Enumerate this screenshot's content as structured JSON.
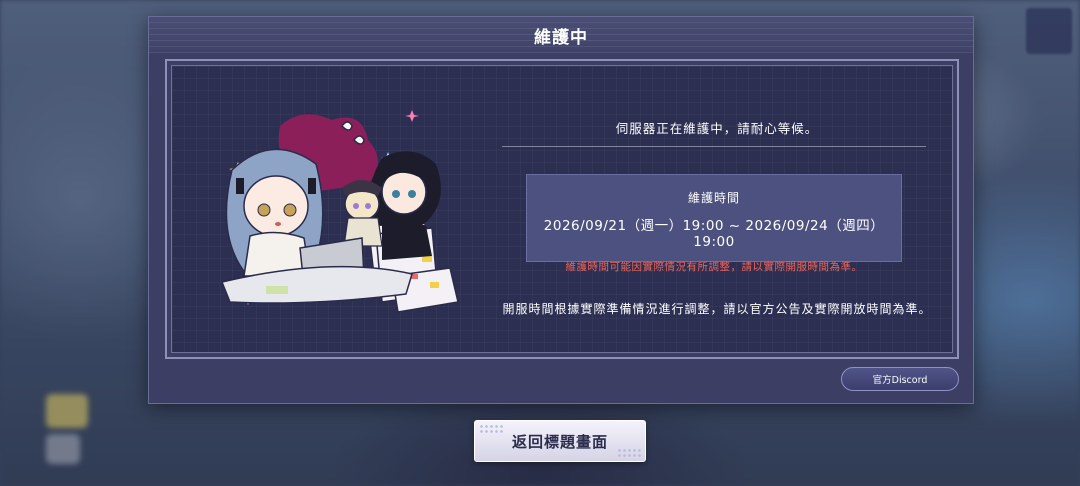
{
  "dialog": {
    "title": "維護中",
    "intro": "伺服器正在維護中，請耐心等候。",
    "maintenance": {
      "label": "維護時間",
      "range": "2026/09/21（週一）19:00 ~ 2026/09/24（週四）19:00",
      "note": "維護時間可能因實際情況有所調整，請以實際開服時間為準。"
    },
    "outro": "開服時間根據實際準備情況進行調整，請以官方公告及實際開放時間為準。",
    "discord_label": "官方Discord"
  },
  "footer": {
    "back_label": "返回標題畫面"
  },
  "colors": {
    "panel": "#3c3f63",
    "time_box": "#4d5180",
    "note_red": "#f0645a"
  }
}
